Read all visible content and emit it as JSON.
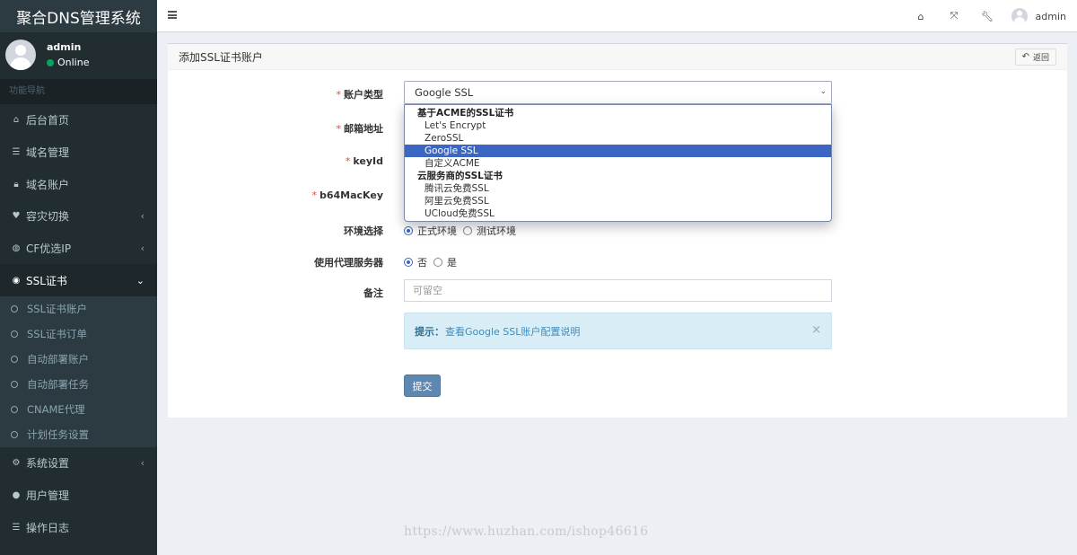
{
  "sidebar": {
    "brand": "聚合DNS管理系统",
    "user": {
      "name": "admin",
      "status": "Online"
    },
    "nav_header": "功能导航",
    "items": [
      {
        "label": "后台首页",
        "icon": "home-icon",
        "glyph": "⌂"
      },
      {
        "label": "域名管理",
        "icon": "list-icon",
        "glyph": "☰"
      },
      {
        "label": "域名账户",
        "icon": "lock-icon",
        "glyph": "🔒︎"
      },
      {
        "label": "容灾切换",
        "icon": "heartbeat-icon",
        "glyph": "♥",
        "has_children": true
      },
      {
        "label": "CF优选IP",
        "icon": "globe-icon",
        "glyph": "◍",
        "has_children": true
      },
      {
        "label": "SSL证书",
        "icon": "certificate-icon",
        "glyph": "◉",
        "has_children": true,
        "open": true
      }
    ],
    "ssl_sub": [
      {
        "label": "SSL证书账户"
      },
      {
        "label": "SSL证书订单"
      },
      {
        "label": "自动部署账户"
      },
      {
        "label": "自动部署任务"
      },
      {
        "label": "CNAME代理"
      },
      {
        "label": "计划任务设置"
      }
    ],
    "bottom_items": [
      {
        "label": "系统设置",
        "icon": "cogs-icon",
        "glyph": "⚙",
        "has_children": true
      },
      {
        "label": "用户管理",
        "icon": "user-icon",
        "glyph": "●"
      },
      {
        "label": "操作日志",
        "icon": "log-list-icon",
        "glyph": "☰"
      }
    ],
    "chev_left": "‹",
    "chev_down": "⌄"
  },
  "header": {
    "icons": {
      "home": "⌂",
      "fullscreen": "⤧",
      "wrench": "🔧︎"
    },
    "user": "admin"
  },
  "box": {
    "title": "添加SSL证书账户",
    "back_label": "返回",
    "back_glyph": "↶"
  },
  "form": {
    "account_type": {
      "label": "账户类型",
      "value": "Google SSL"
    },
    "email": {
      "label": "邮箱地址"
    },
    "keyid": {
      "label": "keyId"
    },
    "b64mackey": {
      "label": "b64MacKey"
    },
    "env": {
      "label": "环境选择",
      "options": [
        "正式环境",
        "测试环境"
      ],
      "selected": 0
    },
    "proxy": {
      "label": "使用代理服务器",
      "options": [
        "否",
        "是"
      ],
      "selected": 0
    },
    "remark": {
      "label": "备注",
      "placeholder": "可留空"
    },
    "tip": {
      "prefix": "提示：",
      "link": "查看Google SSL账户配置说明",
      "close": "×"
    },
    "submit": "提交"
  },
  "dropdown": {
    "groups": [
      {
        "label": "基于ACME的SSL证书",
        "options": [
          "Let's Encrypt",
          "ZeroSSL",
          "Google SSL",
          "自定义ACME"
        ]
      },
      {
        "label": "云服务商的SSL证书",
        "options": [
          "腾讯云免费SSL",
          "阿里云免费SSL",
          "UCloud免费SSL"
        ]
      }
    ],
    "selected": "Google SSL"
  },
  "watermark": "https://www.huzhan.com/ishop46616"
}
